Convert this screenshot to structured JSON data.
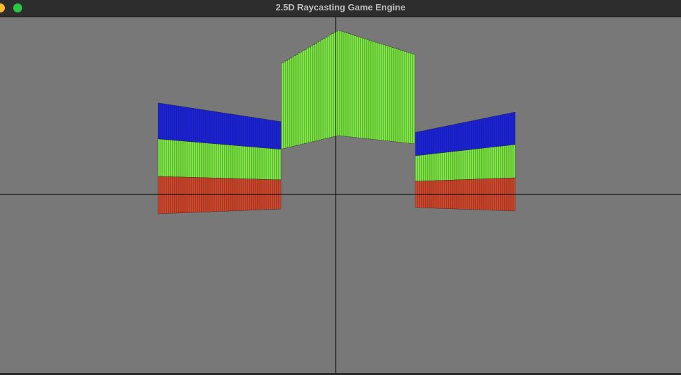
{
  "window": {
    "title": "2.5D Raycasting Game Engine"
  },
  "colors": {
    "background": "#787878",
    "crosshair": "#000000",
    "wall_green": "#7ef043",
    "wall_blue": "#1a22e6",
    "wall_red": "#d9472a",
    "column_line": "#1f1f1f"
  },
  "icons": {
    "minimize": "minimize-icon",
    "maximize": "maximize-icon"
  }
}
